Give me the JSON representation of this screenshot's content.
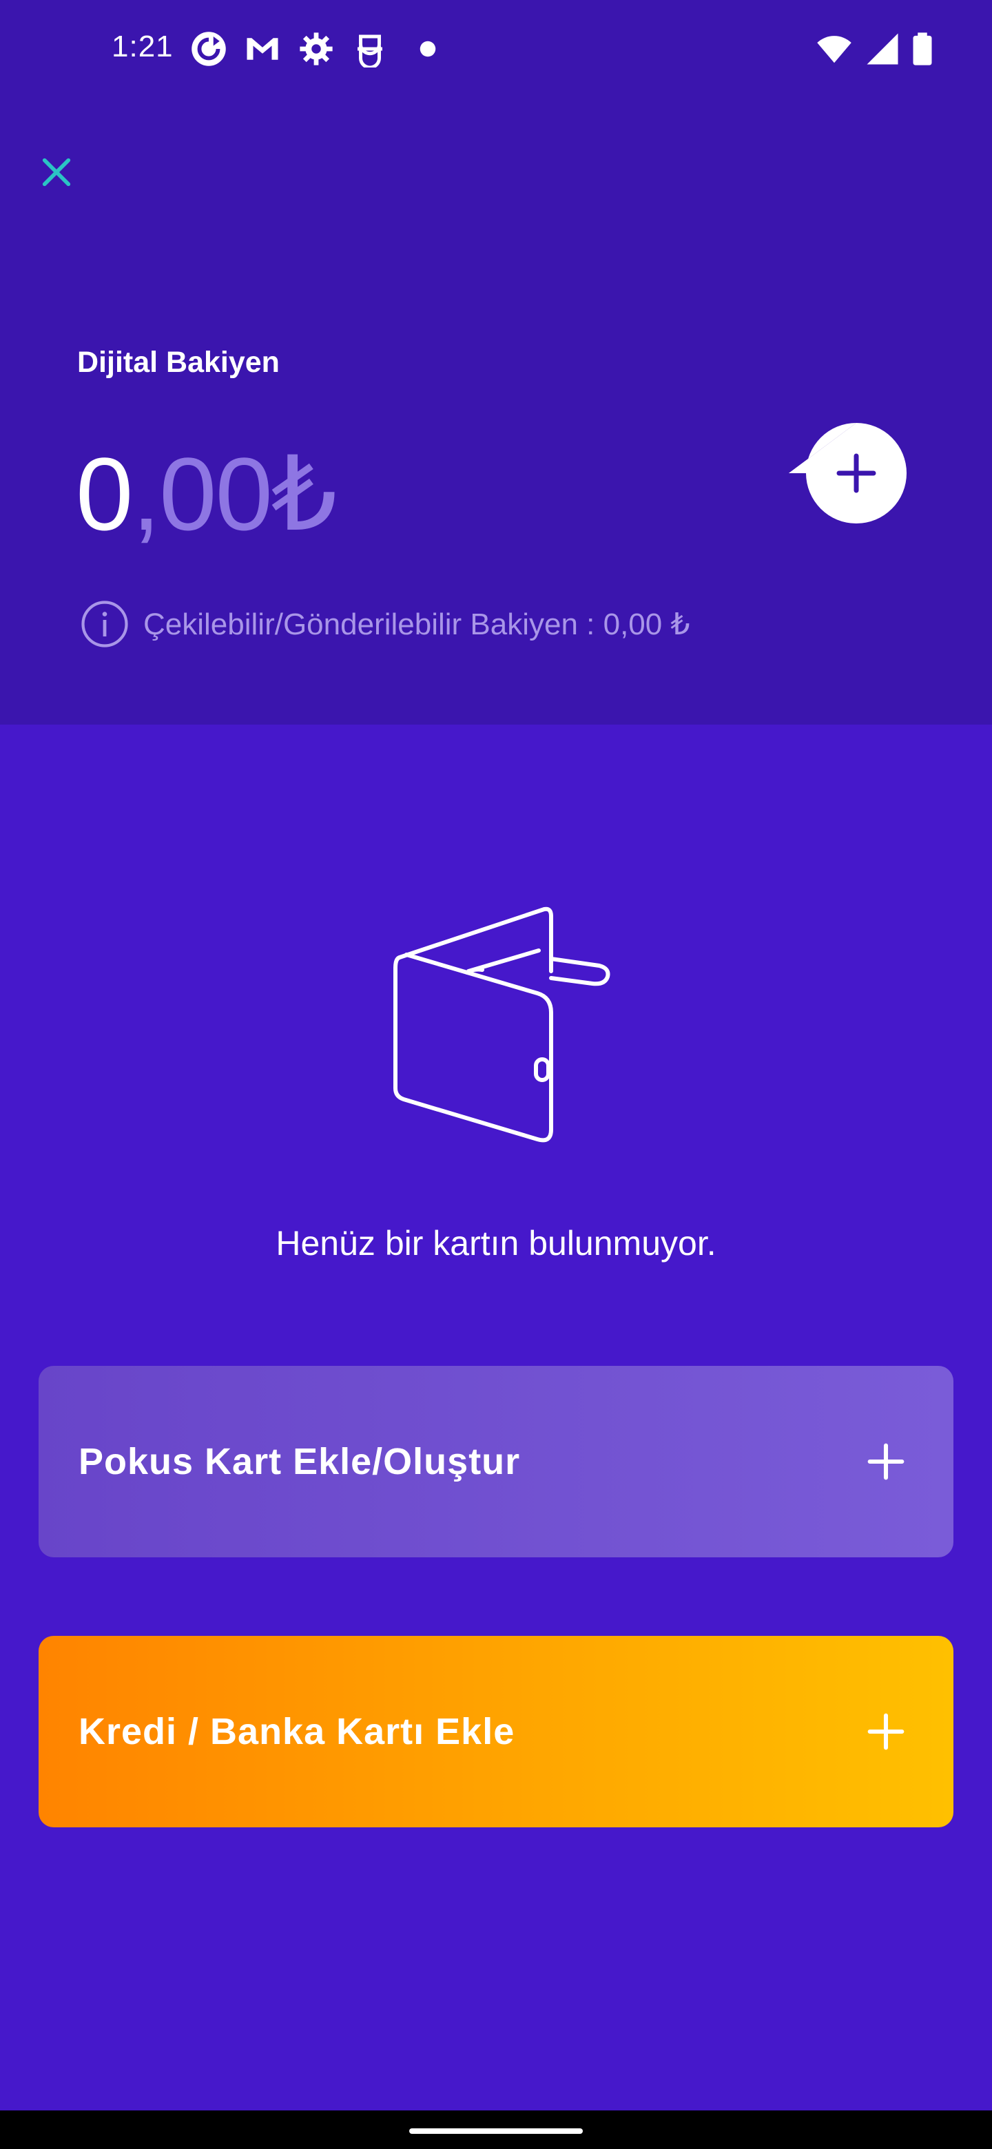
{
  "status_bar": {
    "time": "1:21",
    "icons": [
      "sync-icon",
      "gmail-icon",
      "settings-icon",
      "secure-icon",
      "dot-icon",
      "wifi-icon",
      "signal-icon",
      "battery-icon"
    ]
  },
  "header": {
    "close_icon": "close-icon",
    "balance_title": "Dijital Bakiyen",
    "balance_integer": "0",
    "balance_decimal": ",00",
    "balance_currency": "₺",
    "add_icon": "plus-icon",
    "withdraw_info_icon": "info-icon",
    "withdraw_text": "Çekilebilir/Gönderilebilir Bakiyen : 0,00 ₺"
  },
  "empty_state": {
    "illustration": "wallet-icon",
    "message": "Henüz bir kartın bulunmuyor."
  },
  "actions": {
    "pokus_label": "Pokus Kart Ekle/Oluştur",
    "credit_label": "Kredi / Banka Kartı Ekle"
  },
  "colors": {
    "header_bg": "#3b15ae",
    "body_bg": "#4618cb",
    "accent_teal": "#2bc4c4",
    "orange_start": "#ff8400",
    "orange_end": "#ffc000"
  }
}
